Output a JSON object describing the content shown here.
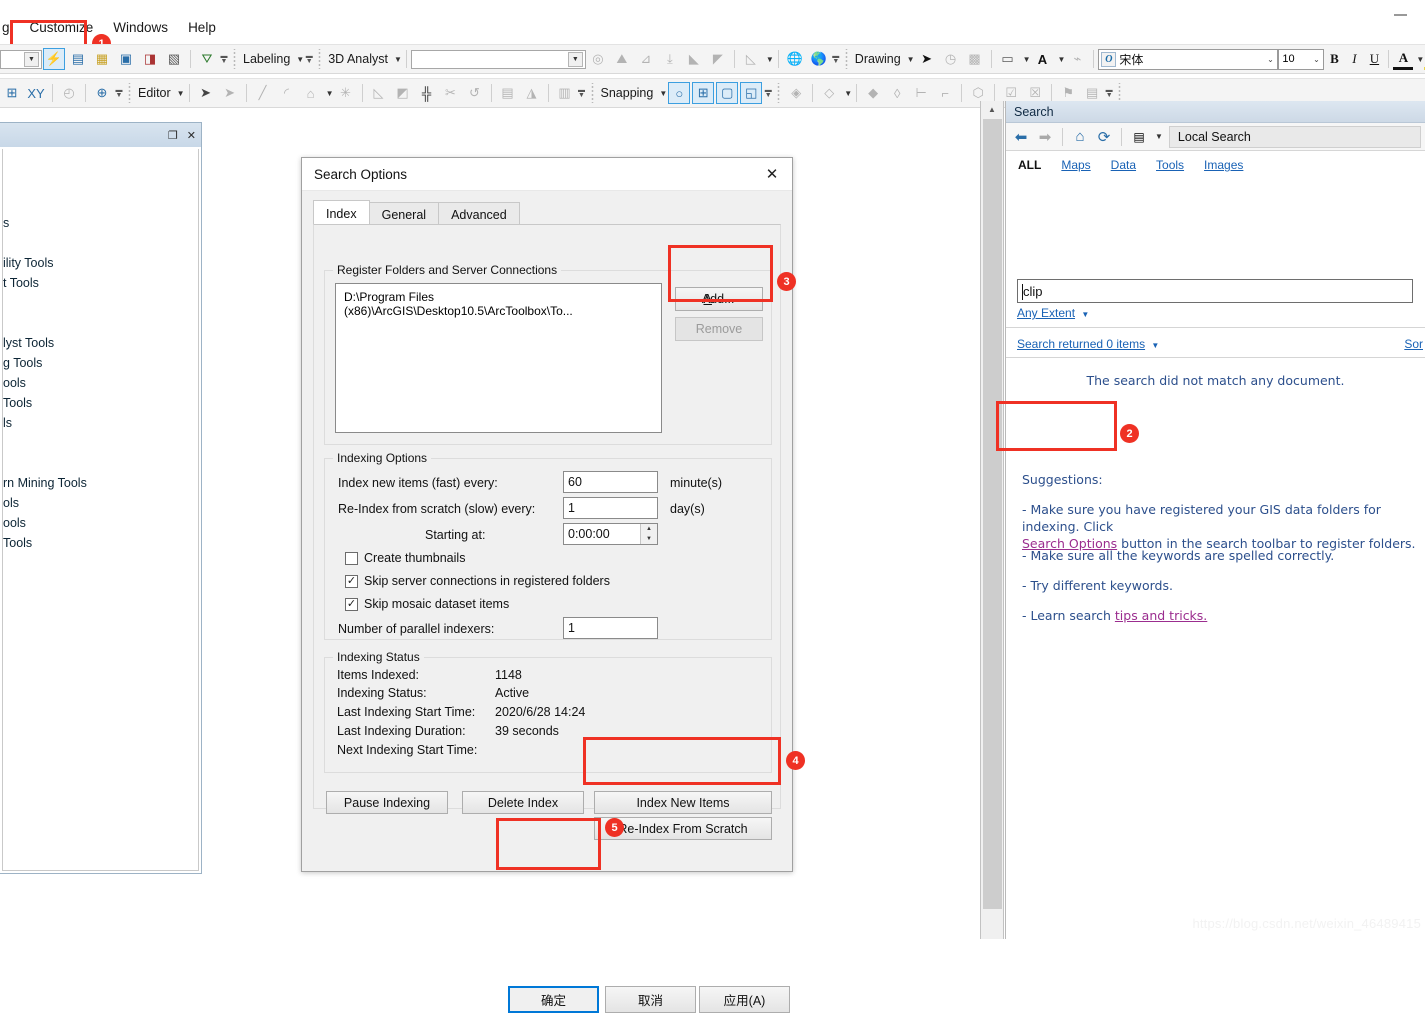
{
  "menubar": {
    "items": [
      {
        "label": "g",
        "name": "menu-item-g"
      },
      {
        "label": "Customize",
        "name": "menu-item-customize"
      },
      {
        "label": "Windows",
        "name": "menu-item-windows"
      },
      {
        "label": "Help",
        "name": "menu-item-help"
      }
    ],
    "highlight_color": "#ef3124",
    "badge_1": "1"
  },
  "toolbar_row1": {
    "combo_value": "",
    "labeling_label": "Labeling",
    "analyst_label": "3D Analyst",
    "drawing_label": "Drawing",
    "font_name": "宋体",
    "font_size": "10",
    "bold": "B",
    "italic": "I",
    "underline": "U",
    "font_color": "A",
    "fill_color": "fill-color-icon"
  },
  "toolbar_row2": {
    "editor_label": "Editor",
    "snapping_label": "Snapping"
  },
  "left_window": {
    "maximize": "maximize-icon",
    "close": "close-icon",
    "rows": [
      "s",
      "",
      "ility Tools",
      "t Tools",
      "",
      "",
      "lyst Tools",
      "g Tools",
      "ools",
      "Tools",
      "ls",
      "",
      "",
      "rn Mining Tools",
      "ols",
      "ools",
      "Tools"
    ]
  },
  "dialog": {
    "title": "Search Options",
    "close_icon": "close-icon",
    "tabs": [
      {
        "label": "Index",
        "selected": true
      },
      {
        "label": "General",
        "selected": false
      },
      {
        "label": "Advanced",
        "selected": false
      }
    ],
    "register_group": {
      "title": "Register Folders and Server Connections",
      "items": [
        "D:\\Program Files (x86)\\ArcGIS\\Desktop10.5\\ArcToolbox\\To..."
      ],
      "add_button": "Add...",
      "remove_button": "Remove",
      "badge_3": "3"
    },
    "indexing_options": {
      "title": "Indexing Options",
      "index_new_label": "Index new items (fast) every:",
      "index_new_value": "60",
      "index_new_unit": "minute(s)",
      "reindex_label": "Re-Index from scratch (slow) every:",
      "reindex_value": "1",
      "reindex_unit": "day(s)",
      "starting_at_label": "Starting at:",
      "starting_at_value": "0:00:00",
      "create_thumbnails": {
        "label": "Create thumbnails",
        "checked": false
      },
      "skip_server": {
        "label": "Skip server connections in registered folders",
        "checked": true
      },
      "skip_mosaic": {
        "label": "Skip mosaic dataset items",
        "checked": true
      },
      "parallel_label": "Number of parallel indexers:",
      "parallel_value": "1"
    },
    "indexing_status": {
      "title": "Indexing Status",
      "rows": [
        {
          "label": "Items Indexed:",
          "value": "1148"
        },
        {
          "label": "Indexing Status:",
          "value": "Active"
        },
        {
          "label": "Last Indexing Start Time:",
          "value": "2020/6/28 14:24"
        },
        {
          "label": "Last Indexing Duration:",
          "value": "39 seconds"
        },
        {
          "label": "Next Indexing Start Time:",
          "value": ""
        }
      ]
    },
    "action_buttons": {
      "pause": "Pause Indexing",
      "delete": "Delete Index",
      "index_new": "Index New Items",
      "reindex_scratch": "Re-Index From Scratch",
      "badge_4": "4"
    },
    "footer": {
      "ok": "确定",
      "cancel": "取消",
      "apply": "应用(A)",
      "badge_5": "5"
    }
  },
  "search_panel": {
    "title": "Search",
    "back_icon": "back-arrow-icon",
    "forward_icon": "forward-arrow-icon",
    "home_icon": "home-icon",
    "refresh_icon": "refresh-icon",
    "list_icon": "list-options-icon",
    "scope_value": "Local Search",
    "categories": [
      {
        "label": "ALL",
        "active": true
      },
      {
        "label": "Maps",
        "active": false
      },
      {
        "label": "Data",
        "active": false
      },
      {
        "label": "Tools",
        "active": false
      },
      {
        "label": "Images",
        "active": false
      }
    ],
    "search_value": "clip",
    "extent_label": "Any Extent",
    "results_label": "Search returned 0 items",
    "sort_label": "Sor",
    "no_match": "The search did not match any document.",
    "suggestions_title": "Suggestions:",
    "suggestions": [
      {
        "prefix": "- Make sure you have registered your GIS data folders for indexing. Click ",
        "link": "Search Options",
        "suffix": " button in the search toolbar to register folders.",
        "badge": "2"
      },
      {
        "prefix": "- Make sure all the keywords are spelled correctly.",
        "link": "",
        "suffix": ""
      },
      {
        "prefix": "- Try different keywords.",
        "link": "",
        "suffix": ""
      },
      {
        "prefix": "- Learn search ",
        "link": "tips and tricks.",
        "suffix": ""
      }
    ]
  },
  "watermark": "https://blog.csdn.net/weixin_46489415"
}
